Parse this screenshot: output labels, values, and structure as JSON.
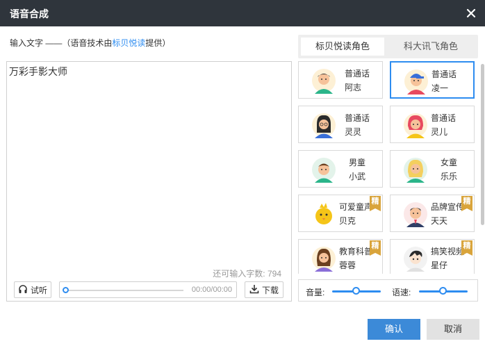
{
  "window": {
    "title": "语音合成"
  },
  "instruction": {
    "prefix": "输入文字 ——（语音技术由",
    "link": "标贝悦读",
    "suffix": "提供）"
  },
  "editor": {
    "text": "万彩手影大师",
    "remaining_label": "还可输入字数:",
    "remaining_count": "794"
  },
  "player": {
    "try_label": "试听",
    "time": "00:00/00:00",
    "download_label": "下载",
    "progress": 0
  },
  "tabs": [
    {
      "label": "标贝悦读角色",
      "active": true
    },
    {
      "label": "科大讯飞角色",
      "active": false
    }
  ],
  "voices": [
    {
      "line1": "普通话",
      "line2": "阿志",
      "selected": false,
      "premium": false
    },
    {
      "line1": "普通话",
      "line2": "凌一",
      "selected": true,
      "premium": false
    },
    {
      "line1": "普通话",
      "line2": "灵灵",
      "selected": false,
      "premium": false
    },
    {
      "line1": "普通话",
      "line2": "灵儿",
      "selected": false,
      "premium": false
    },
    {
      "line1": "男童",
      "line2": "小武",
      "selected": false,
      "premium": false
    },
    {
      "line1": "女童",
      "line2": "乐乐",
      "selected": false,
      "premium": false
    },
    {
      "line1": "可爱童声",
      "line2": "贝克",
      "selected": false,
      "premium": true
    },
    {
      "line1": "品牌宣传",
      "line2": "天天",
      "selected": false,
      "premium": true
    },
    {
      "line1": "教育科普",
      "line2": "蓉蓉",
      "selected": false,
      "premium": true
    },
    {
      "line1": "搞笑视频",
      "line2": "星仔",
      "selected": false,
      "premium": true
    }
  ],
  "premium_badge": "精",
  "controls": {
    "volume_label": "音量:",
    "volume_level": 0.5,
    "speed_label": "语速:",
    "speed_level": 0.5
  },
  "buttons": {
    "ok": "确认",
    "cancel": "取消"
  },
  "colors": {
    "accent": "#2d8cf0",
    "titlebar": "#2f353c",
    "premium": "#d9a43b"
  }
}
